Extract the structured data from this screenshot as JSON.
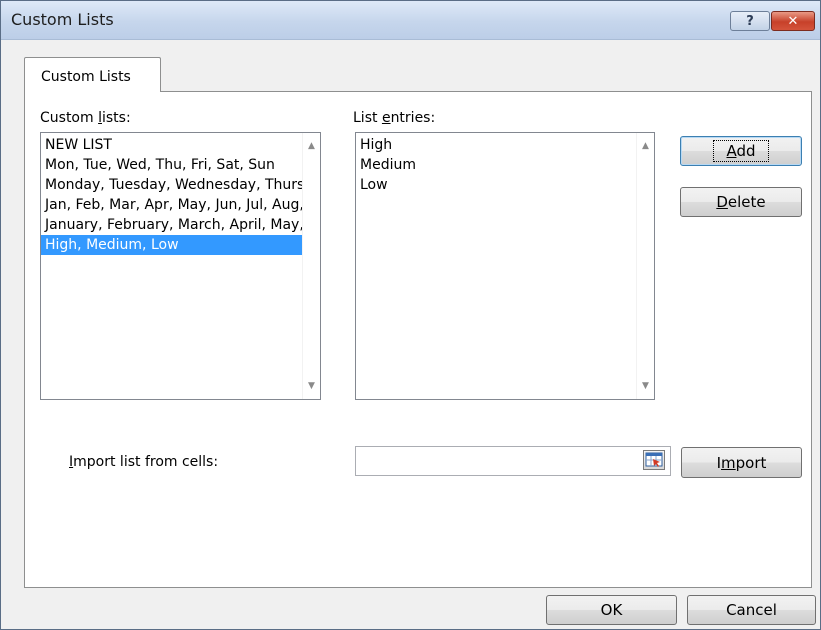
{
  "window": {
    "title": "Custom Lists",
    "help_glyph": "?",
    "close_glyph": "✕"
  },
  "tab": {
    "label": "Custom Lists"
  },
  "custom_lists": {
    "label_pre": "Custom ",
    "label_mn": "l",
    "label_post": "ists:",
    "items": [
      "NEW LIST",
      "Mon, Tue, Wed, Thu, Fri, Sat, Sun",
      "Monday, Tuesday, Wednesday, Thursday, Friday, Saturday, Sunday",
      "Jan, Feb, Mar, Apr, May, Jun, Jul, Aug, Sep, Oct, Nov, Dec",
      "January, February, March, April, May, June, July, August, September, October, November, December",
      "High, Medium, Low"
    ],
    "selected_index": 5
  },
  "list_entries": {
    "label_pre": "List ",
    "label_mn": "e",
    "label_post": "ntries:",
    "items": [
      "High",
      "Medium",
      "Low"
    ]
  },
  "buttons": {
    "add_mn": "A",
    "add_rest": "dd",
    "delete_mn": "D",
    "delete_rest": "elete",
    "import_pre": "I",
    "import_mn": "m",
    "import_post": "port",
    "ok": "OK",
    "cancel": "Cancel"
  },
  "import": {
    "label_mn": "I",
    "label_rest": "mport list from cells:",
    "value": ""
  },
  "icons": {
    "scroll_up": "▲",
    "scroll_down": "▼"
  },
  "colors": {
    "selection": "#3399ff",
    "close_button": "#c7412a"
  }
}
